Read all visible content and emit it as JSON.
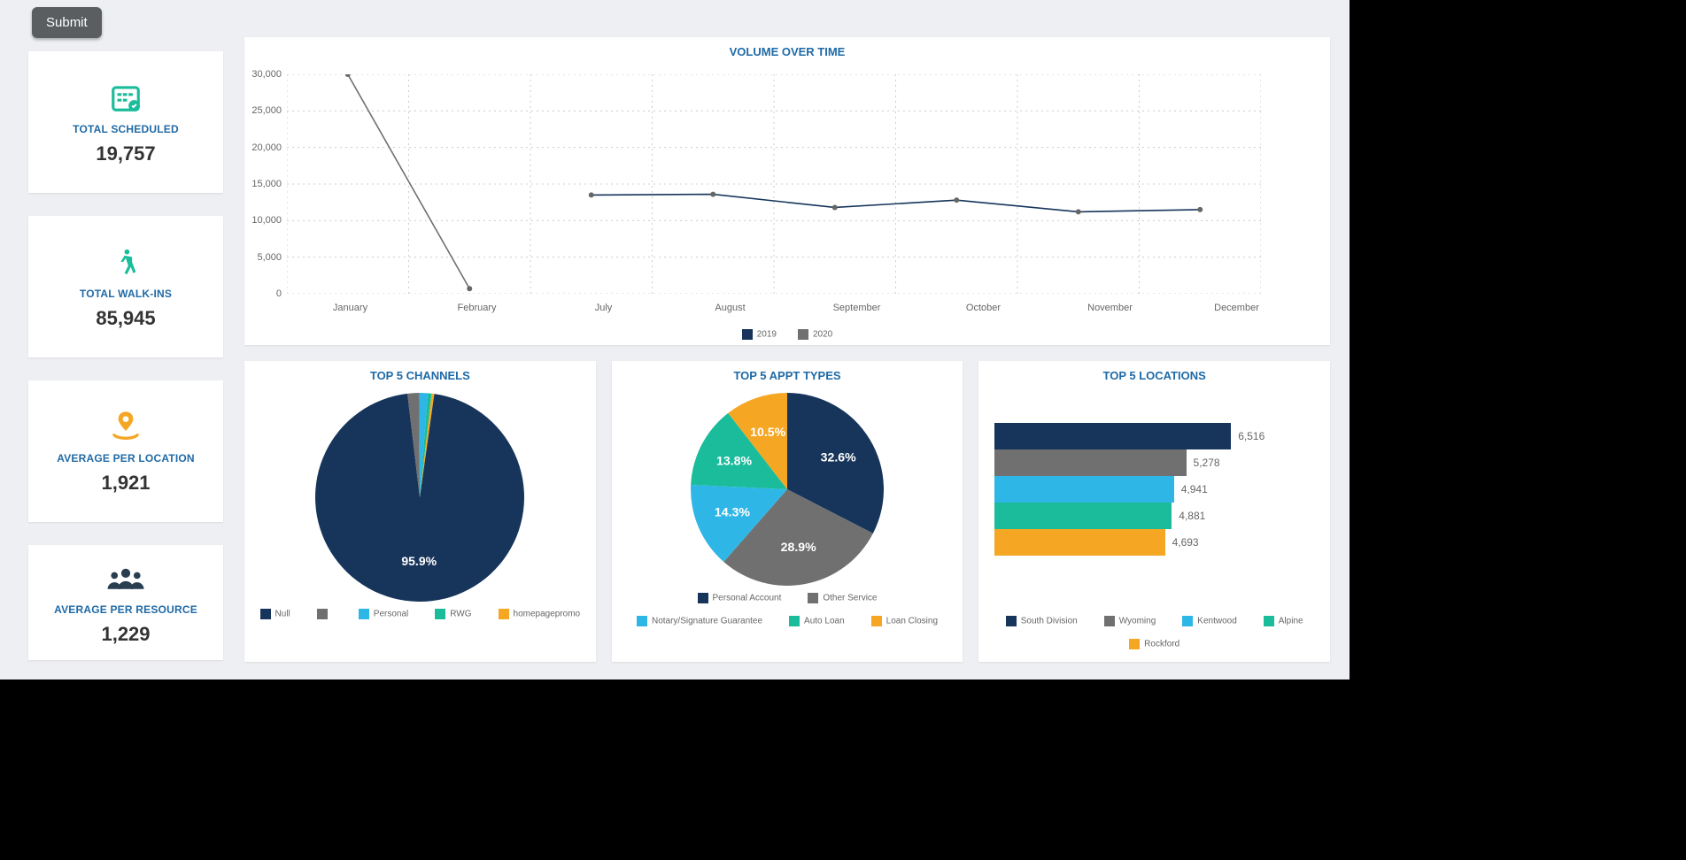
{
  "buttons": {
    "submit": "Submit"
  },
  "metrics": {
    "scheduled": {
      "label": "TOTAL SCHEDULED",
      "value": "19,757"
    },
    "walkins": {
      "label": "TOTAL WALK-INS",
      "value": "85,945"
    },
    "avg_loc": {
      "label": "AVERAGE PER LOCATION",
      "value": "1,921"
    },
    "avg_res": {
      "label": "AVERAGE PER RESOURCE",
      "value": "1,229"
    }
  },
  "colors": {
    "navy": "#17355b",
    "grey": "#707070",
    "cyan": "#2eb7e6",
    "teal": "#1bbc9b",
    "orange": "#f5a623"
  },
  "chart_data": [
    {
      "id": "volume_over_time",
      "type": "line",
      "title": "VOLUME OVER TIME",
      "xlabel": "",
      "ylabel": "",
      "ylim": [
        0,
        30000
      ],
      "yticks": [
        0,
        5000,
        10000,
        15000,
        20000,
        25000,
        30000
      ],
      "ytick_labels": [
        "0",
        "5,000",
        "10,000",
        "15,000",
        "20,000",
        "25,000",
        "30,000"
      ],
      "categories": [
        "January",
        "February",
        "July",
        "August",
        "September",
        "October",
        "November",
        "December"
      ],
      "series": [
        {
          "name": "2019",
          "color": "#17355b",
          "values": [
            null,
            null,
            13500,
            13600,
            11800,
            12800,
            11200,
            11500
          ]
        },
        {
          "name": "2020",
          "color": "#707070",
          "values": [
            30000,
            700,
            null,
            null,
            null,
            null,
            null,
            null
          ]
        }
      ]
    },
    {
      "id": "top5_channels",
      "type": "pie",
      "title": "TOP 5 CHANNELS",
      "series": [
        {
          "name": "Null",
          "value": 95.9,
          "label": "95.9%",
          "color": "#17355b"
        },
        {
          "name": "",
          "value": 1.8,
          "label": "",
          "color": "#707070"
        },
        {
          "name": "Personal",
          "value": 1.3,
          "label": "",
          "color": "#2eb7e6"
        },
        {
          "name": "RWG",
          "value": 0.6,
          "label": "",
          "color": "#1bbc9b"
        },
        {
          "name": "homepagepromo",
          "value": 0.4,
          "label": "",
          "color": "#f5a623"
        }
      ]
    },
    {
      "id": "top5_appt_types",
      "type": "pie",
      "title": "TOP 5 APPT TYPES",
      "series": [
        {
          "name": "Personal Account",
          "value": 32.6,
          "label": "32.6%",
          "color": "#17355b"
        },
        {
          "name": "Other Service",
          "value": 28.9,
          "label": "28.9%",
          "color": "#707070"
        },
        {
          "name": "Notary/Signature Guarantee",
          "value": 14.3,
          "label": "14.3%",
          "color": "#2eb7e6"
        },
        {
          "name": "Auto Loan",
          "value": 13.8,
          "label": "13.8%",
          "color": "#1bbc9b"
        },
        {
          "name": "Loan Closing",
          "value": 10.5,
          "label": "10.5%",
          "color": "#f5a623"
        }
      ]
    },
    {
      "id": "top5_locations",
      "type": "bar",
      "orientation": "horizontal",
      "title": "TOP 5 LOCATIONS",
      "xlim": [
        0,
        6516
      ],
      "series": [
        {
          "name": "South Division",
          "value": 6516,
          "label": "6,516",
          "color": "#17355b"
        },
        {
          "name": "Wyoming",
          "value": 5278,
          "label": "5,278",
          "color": "#707070"
        },
        {
          "name": "Kentwood",
          "value": 4941,
          "label": "4,941",
          "color": "#2eb7e6"
        },
        {
          "name": "Alpine",
          "value": 4881,
          "label": "4,881",
          "color": "#1bbc9b"
        },
        {
          "name": "Rockford",
          "value": 4693,
          "label": "4,693",
          "color": "#f5a623"
        }
      ]
    }
  ]
}
